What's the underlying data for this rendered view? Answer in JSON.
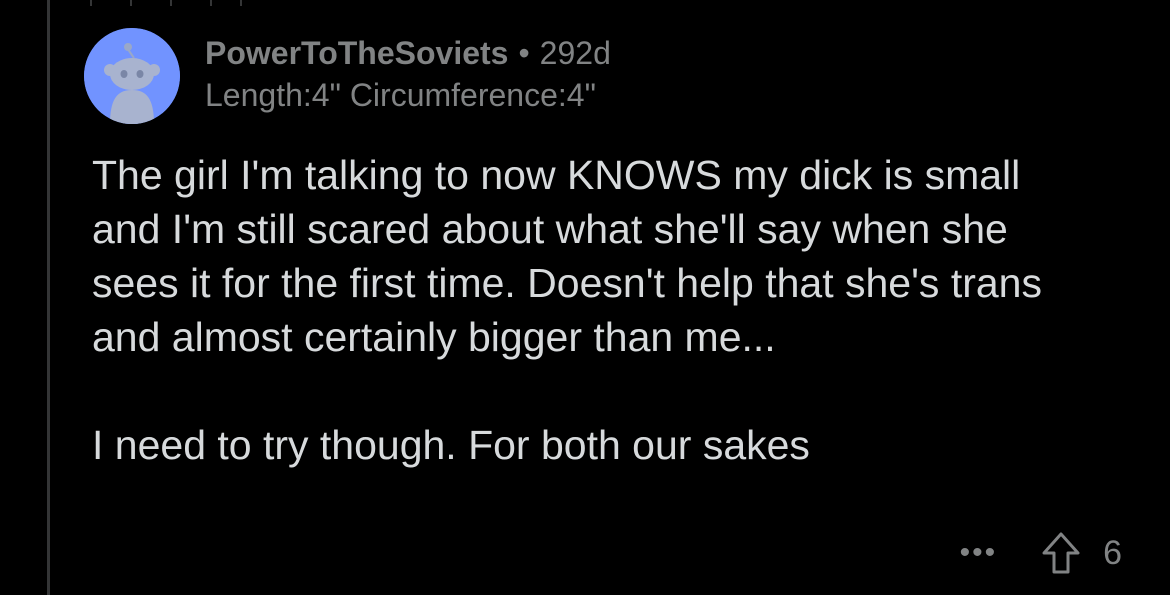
{
  "comment": {
    "author": "PowerToTheSoviets",
    "separator": "•",
    "age": "292d",
    "flair": "Length:4\" Circumference:4\"",
    "paragraphs": [
      "The girl I'm talking to now KNOWS my dick is small and I'm still scared about what she'll say when she sees it for the first time. Doesn't help that she's trans and almost certainly bigger than me...",
      "I need to try though. For both our sakes"
    ],
    "actions": {
      "more_label": "•••",
      "upvote_icon": "upvote-arrow-icon",
      "score": "6"
    }
  },
  "colors": {
    "background": "#000000",
    "body_text": "#d7dadc",
    "meta_text": "#818384",
    "avatar_bg": "#7193ff",
    "thread_line": "#343536"
  }
}
